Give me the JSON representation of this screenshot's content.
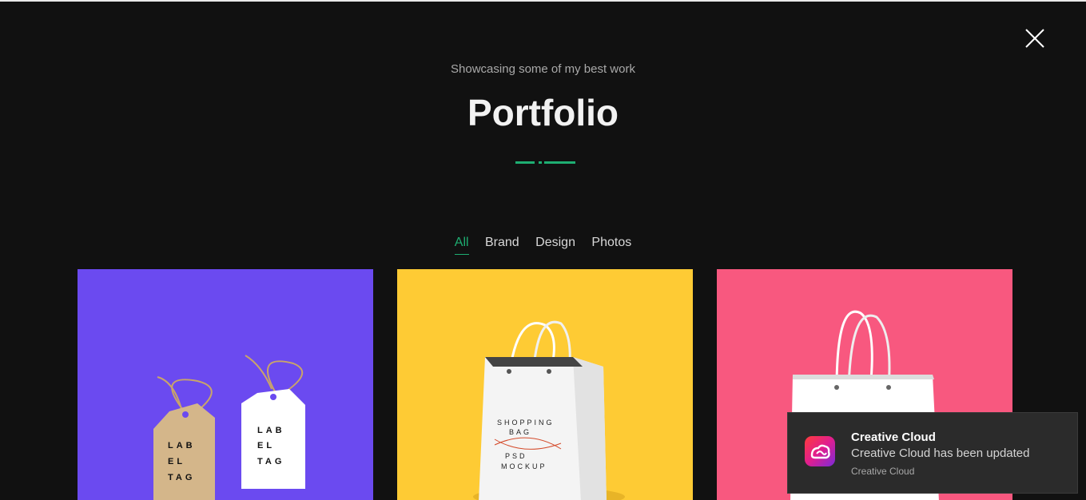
{
  "header": {
    "subtitle": "Showcasing some of my best work",
    "title": "Portfolio"
  },
  "filters": [
    {
      "label": "All",
      "active": true
    },
    {
      "label": "Brand",
      "active": false
    },
    {
      "label": "Design",
      "active": false
    },
    {
      "label": "Photos",
      "active": false
    }
  ],
  "portfolio_items": [
    {
      "background": "#6b4af0",
      "tag_left_text": [
        "LAB",
        "EL",
        "TAG"
      ],
      "tag_right_text": [
        "LAB",
        "EL",
        "TAG"
      ]
    },
    {
      "background": "#fecb34",
      "bag_text": [
        "SHOPPING",
        "BAG",
        "MOCKUP",
        "PSD"
      ]
    },
    {
      "background": "#f8587f"
    }
  ],
  "notification": {
    "app_name": "Creative Cloud",
    "message": "Creative Cloud has been updated",
    "source": "Creative Cloud",
    "icon": "creative-cloud-icon"
  },
  "colors": {
    "accent": "#1eae72",
    "background": "#111111"
  },
  "icons": {
    "close": "close-icon"
  }
}
